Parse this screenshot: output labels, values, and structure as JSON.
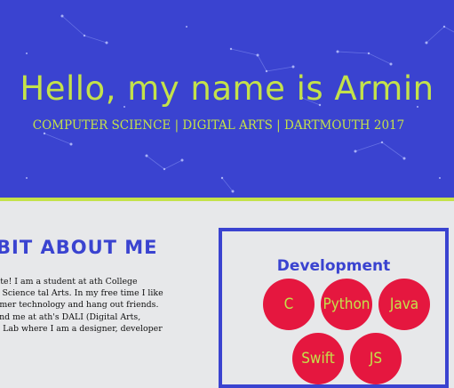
{
  "hero": {
    "title": "Hello, my name is Armin",
    "subtitle": "COMPUTER SCIENCE | DIGITAL ARTS | DARTMOUTH 2017"
  },
  "about": {
    "title": "BIT ABOUT ME",
    "body": "for vising my website! I am a student at ath College studying Computer Science tal Arts. In my free time I like to play ollow consumer technology and hang out friends. You can probably find me at ath's DALI (Digital Arts, Leadership and on) Lab where I am a designer, developer ator."
  },
  "skills": {
    "title": "Development",
    "items": [
      "C",
      "Python",
      "Java",
      "Swift",
      "JS"
    ]
  },
  "colors": {
    "hero_bg": "#3a43d0",
    "accent": "#c4e24a",
    "bubble": "#e5173f",
    "page_bg": "#e7e8ea"
  }
}
